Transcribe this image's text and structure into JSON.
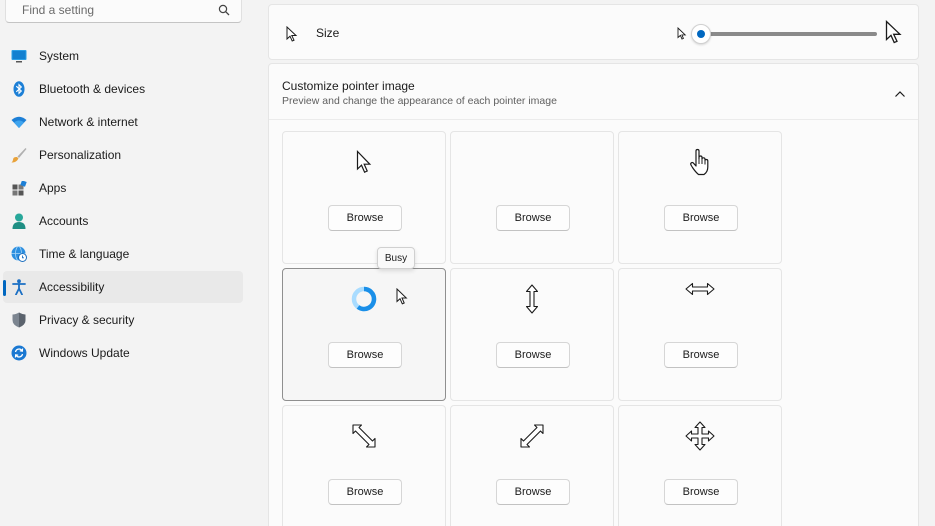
{
  "search": {
    "placeholder": "Find a setting"
  },
  "sidebar": {
    "items": [
      {
        "label": "System",
        "icon": "system-icon"
      },
      {
        "label": "Bluetooth & devices",
        "icon": "bluetooth-icon"
      },
      {
        "label": "Network & internet",
        "icon": "wifi-icon"
      },
      {
        "label": "Personalization",
        "icon": "brush-icon"
      },
      {
        "label": "Apps",
        "icon": "apps-icon"
      },
      {
        "label": "Accounts",
        "icon": "person-icon"
      },
      {
        "label": "Time & language",
        "icon": "globe-clock-icon"
      },
      {
        "label": "Accessibility",
        "icon": "accessibility-icon",
        "active": true
      },
      {
        "label": "Privacy & security",
        "icon": "shield-icon"
      },
      {
        "label": "Windows Update",
        "icon": "update-icon"
      }
    ]
  },
  "size": {
    "label": "Size",
    "value": 0
  },
  "customize": {
    "title": "Customize pointer image",
    "subtitle": "Preview and change the appearance of each pointer image",
    "tiles": [
      {
        "icon": "arrow-pointer-icon",
        "browse": "Browse"
      },
      {
        "icon": "",
        "browse": "Browse"
      },
      {
        "icon": "hand-pointer-icon",
        "browse": "Browse"
      },
      {
        "icon": "busy-ring-icon",
        "browse": "Browse"
      },
      {
        "icon": "vertical-resize-icon",
        "browse": "Browse"
      },
      {
        "icon": "horizontal-resize-icon",
        "browse": "Browse"
      },
      {
        "icon": "diagonal-resize-nwse-icon",
        "browse": "Browse"
      },
      {
        "icon": "diagonal-resize-nesw-icon",
        "browse": "Browse"
      },
      {
        "icon": "move-icon",
        "browse": "Browse"
      }
    ]
  },
  "tooltip": {
    "text": "Busy"
  },
  "colors": {
    "accent": "#0067c0"
  }
}
